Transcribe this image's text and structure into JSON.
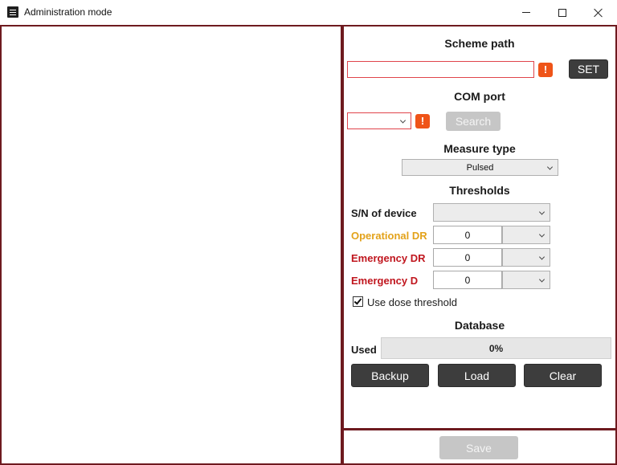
{
  "window": {
    "title": "Administration mode",
    "icon": "app-icon"
  },
  "scheme": {
    "heading": "Scheme path",
    "path_value": "",
    "warn_glyph": "!",
    "set_label": "SET"
  },
  "com": {
    "heading": "COM port",
    "selected": "",
    "warn_glyph": "!",
    "search_label": "Search"
  },
  "measure": {
    "heading": "Measure type",
    "selected": "Pulsed"
  },
  "thresholds": {
    "heading": "Thresholds",
    "sn_label": "S/N of device",
    "sn_selected": "",
    "rows": [
      {
        "label": "Operational DR",
        "value": "0",
        "unit": "",
        "color": "#e3a21a"
      },
      {
        "label": "Emergency DR",
        "value": "0",
        "unit": "",
        "color": "#c0161e"
      },
      {
        "label": "Emergency D",
        "value": "0",
        "unit": "",
        "color": "#c0161e"
      }
    ],
    "use_dose_label": "Use dose threshold",
    "use_dose_checked": true
  },
  "database": {
    "heading": "Database",
    "used_label": "Used",
    "used_text": "0%",
    "used_percent": 0,
    "backup_label": "Backup",
    "load_label": "Load",
    "clear_label": "Clear"
  },
  "footer": {
    "save_label": "Save"
  },
  "colors": {
    "panel_border": "#6e1a1f",
    "warning": "#ef5418",
    "button_dark": "#3d3d3d",
    "button_disabled": "#c6c6c6"
  }
}
